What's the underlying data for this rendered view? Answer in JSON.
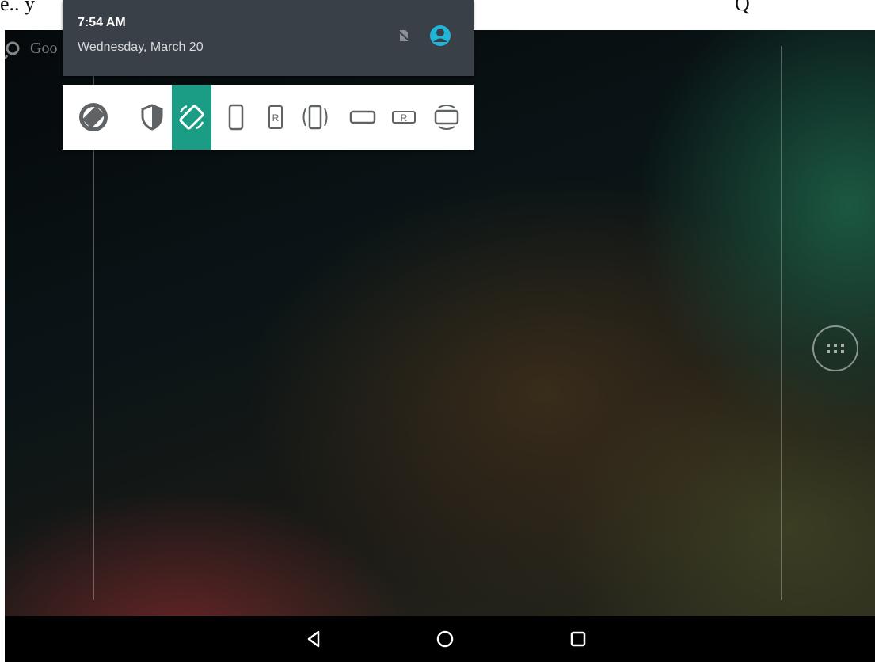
{
  "document": {
    "left_text": "e.. y",
    "right_text": "Q"
  },
  "home": {
    "search_placeholder": "Goo"
  },
  "notification": {
    "time": "7:54 AM",
    "date": "Wednesday, March 20",
    "user_icon_color": "#1fb6d9"
  },
  "rotation_toolbar": {
    "buttons": [
      {
        "icon": "auto-rotate-circle-icon"
      },
      {
        "icon": "shield-icon"
      },
      {
        "icon": "auto-rotate-icon",
        "selected": true
      },
      {
        "icon": "portrait-icon"
      },
      {
        "icon": "reverse-portrait-icon",
        "label": "R"
      },
      {
        "icon": "portrait-sensor-icon"
      },
      {
        "icon": "landscape-icon"
      },
      {
        "icon": "reverse-landscape-icon",
        "label": "R"
      },
      {
        "icon": "landscape-sensor-icon"
      }
    ],
    "accent_color": "#1b9c85"
  },
  "navigation": {
    "buttons": [
      "back",
      "home",
      "recents"
    ]
  }
}
